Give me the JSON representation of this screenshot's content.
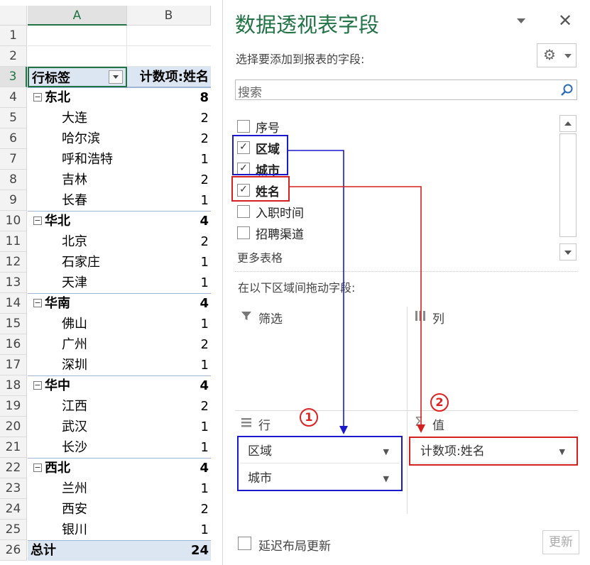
{
  "sheet": {
    "col_a": "A",
    "col_b": "B",
    "rows": [
      "1",
      "2",
      "3",
      "4",
      "5",
      "6",
      "7",
      "8",
      "9",
      "10",
      "11",
      "12",
      "13",
      "14",
      "15",
      "16",
      "17",
      "18",
      "19",
      "20",
      "21",
      "22",
      "23",
      "24",
      "25",
      "26"
    ],
    "header": {
      "label": "行标签",
      "value": "计数项:姓名"
    },
    "groups": [
      {
        "name": "东北",
        "count": "8",
        "items": [
          [
            "大连",
            "2"
          ],
          [
            "哈尔滨",
            "2"
          ],
          [
            "呼和浩特",
            "1"
          ],
          [
            "吉林",
            "2"
          ],
          [
            "长春",
            "1"
          ]
        ]
      },
      {
        "name": "华北",
        "count": "4",
        "items": [
          [
            "北京",
            "2"
          ],
          [
            "石家庄",
            "1"
          ],
          [
            "天津",
            "1"
          ]
        ]
      },
      {
        "name": "华南",
        "count": "4",
        "items": [
          [
            "佛山",
            "1"
          ],
          [
            "广州",
            "2"
          ],
          [
            "深圳",
            "1"
          ]
        ]
      },
      {
        "name": "华中",
        "count": "4",
        "items": [
          [
            "江西",
            "2"
          ],
          [
            "武汉",
            "1"
          ],
          [
            "长沙",
            "1"
          ]
        ]
      },
      {
        "name": "西北",
        "count": "4",
        "items": [
          [
            "兰州",
            "1"
          ],
          [
            "西安",
            "2"
          ],
          [
            "银川",
            "1"
          ]
        ]
      }
    ],
    "total": {
      "label": "总计",
      "value": "24"
    },
    "collapse_glyph": "−"
  },
  "panel": {
    "title": "数据透视表字段",
    "subtitle": "选择要添加到报表的字段:",
    "search_placeholder": "搜索",
    "fields": [
      {
        "label": "序号",
        "checked": false
      },
      {
        "label": "区域",
        "checked": true
      },
      {
        "label": "城市",
        "checked": true
      },
      {
        "label": "姓名",
        "checked": true
      },
      {
        "label": "入职时间",
        "checked": false
      },
      {
        "label": "招聘渠道",
        "checked": false
      }
    ],
    "more_tables": "更多表格",
    "drag_hint": "在以下区域间拖动字段:",
    "areas": {
      "filter": "筛选",
      "columns": "列",
      "rows": "行",
      "values": "值"
    },
    "rows_items": [
      "区域",
      "城市"
    ],
    "values_items": [
      "计数项:姓名"
    ],
    "defer_label": "延迟布局更新",
    "update_button": "更新",
    "markers": {
      "one": "①",
      "two": "②"
    },
    "colors": {
      "title": "#217346",
      "blue_box": "#1a1acc",
      "red_box": "#d42020",
      "header_fill": "#dce6f2"
    }
  }
}
